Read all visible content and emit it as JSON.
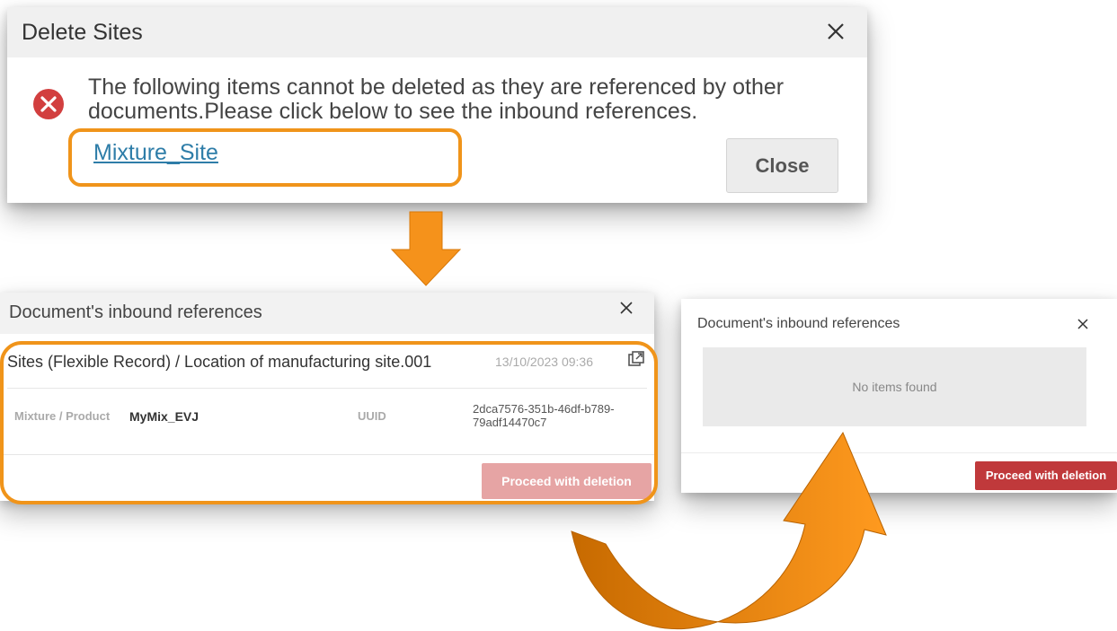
{
  "delete_dialog": {
    "title": "Delete Sites",
    "message": "The following items cannot be deleted as they are referenced by other documents.Please click below to see the inbound references.",
    "link": "Mixture_Site",
    "close_button": "Close"
  },
  "references_dialog": {
    "title": "Document's inbound references",
    "record_title": "Sites (Flexible Record) / Location of manufacturing site.001",
    "record_time": "13/10/2023 09:36",
    "row_label": "Mixture / Product",
    "row_value": "MyMix_EVJ",
    "uuid_label": "UUID",
    "uuid_value": "2dca7576-351b-46df-b789-79adf14470c7",
    "proceed_button": "Proceed with deletion"
  },
  "empty_dialog": {
    "title": "Document's inbound references",
    "empty_text": "No items found",
    "proceed_button": "Proceed with deletion"
  },
  "colors": {
    "highlight": "#f0941a",
    "danger": "#c0393b",
    "danger_disabled": "#e6a4a4",
    "link": "#2e7da8",
    "error_icon": "#d23f3f"
  },
  "icons": [
    "close-icon",
    "error-icon",
    "open-in-new-icon",
    "down-arrow",
    "curved-arrow"
  ]
}
